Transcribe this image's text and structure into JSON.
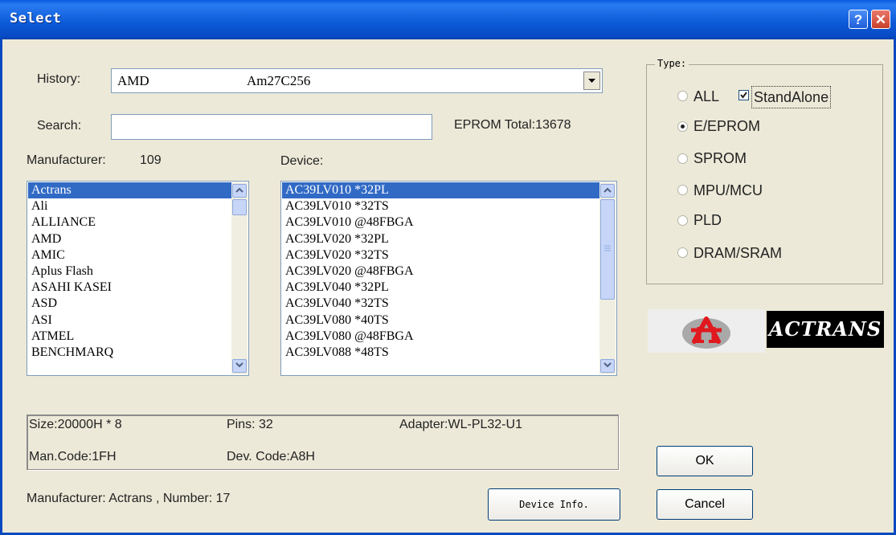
{
  "window": {
    "title": "Select",
    "help_glyph": "?",
    "close_glyph": "✕"
  },
  "history": {
    "label": "History:",
    "manufacturer": "AMD",
    "device": "Am27C256"
  },
  "search": {
    "label": "Search:",
    "value": "",
    "total_text": "EPROM Total:13678"
  },
  "manufacturer_list": {
    "label": "Manufacturer:",
    "count": "109",
    "items": [
      "Actrans",
      "Ali",
      "ALLIANCE",
      "AMD",
      "AMIC",
      "Aplus Flash",
      "ASAHI KASEI",
      "ASD",
      "ASI",
      "ATMEL",
      "BENCHMARQ"
    ],
    "selected_index": 0
  },
  "device_list": {
    "label": "Device:",
    "items": [
      "AC39LV010 *32PL",
      "AC39LV010 *32TS",
      "AC39LV010 @48FBGA",
      "AC39LV020 *32PL",
      "AC39LV020 *32TS",
      "AC39LV020 @48FBGA",
      "AC39LV040 *32PL",
      "AC39LV040 *32TS",
      "AC39LV080 *40TS",
      "AC39LV080 @48FBGA",
      "AC39LV088 *48TS"
    ],
    "selected_index": 0
  },
  "type_group": {
    "legend": "Type:",
    "options": [
      {
        "label": "ALL",
        "selected": false
      },
      {
        "label": "E/EPROM",
        "selected": true
      },
      {
        "label": "SPROM",
        "selected": false
      },
      {
        "label": "MPU/MCU",
        "selected": false
      },
      {
        "label": "PLD",
        "selected": false
      },
      {
        "label": "DRAM/SRAM",
        "selected": false
      }
    ],
    "standalone": {
      "label": "StandAlone",
      "checked": true
    }
  },
  "logo": {
    "text": "ACTRANS",
    "icon": "actrans-logo-icon",
    "colors": {
      "red": "#e0191f",
      "gray": "#a9a9a9"
    }
  },
  "info": {
    "size": "Size:20000H * 8",
    "pins": "Pins: 32",
    "adapter": "Adapter:WL-PL32-U1",
    "man_code": "Man.Code:1FH",
    "dev_code": "Dev. Code:A8H"
  },
  "status_text": "Manufacturer: Actrans , Number: 17",
  "buttons": {
    "device_info": "Device Info.",
    "ok": "OK",
    "cancel": "Cancel"
  },
  "colors": {
    "titlebar": "#0a5ae0",
    "selection": "#316ac5",
    "dialog_bg": "#ece9d8"
  }
}
